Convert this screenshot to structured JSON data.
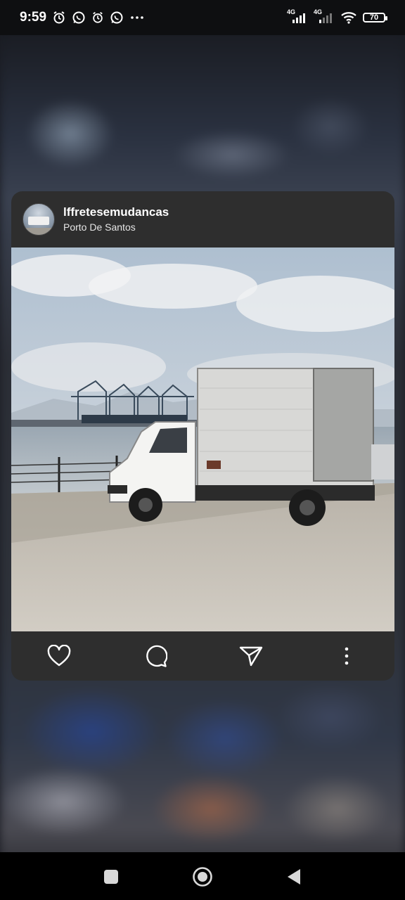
{
  "status_bar": {
    "time": "9:59",
    "left_icons": [
      "alarm-icon",
      "whatsapp-icon",
      "alarm-icon",
      "whatsapp-icon",
      "more-dots-icon"
    ],
    "network_1": "4G",
    "network_2": "4G",
    "battery": "70"
  },
  "post": {
    "username": "lffretesemudancas",
    "location": "Porto De Santos",
    "actions": [
      "like-icon",
      "comment-icon",
      "share-icon",
      "more-options-icon"
    ]
  },
  "navigation": [
    "recents-square-icon",
    "home-circle-icon",
    "back-triangle-icon"
  ],
  "colors": {
    "card_background": "#2e2e2e",
    "status_bar_background": "#0e0f11",
    "nav_bar_background": "#000000"
  }
}
